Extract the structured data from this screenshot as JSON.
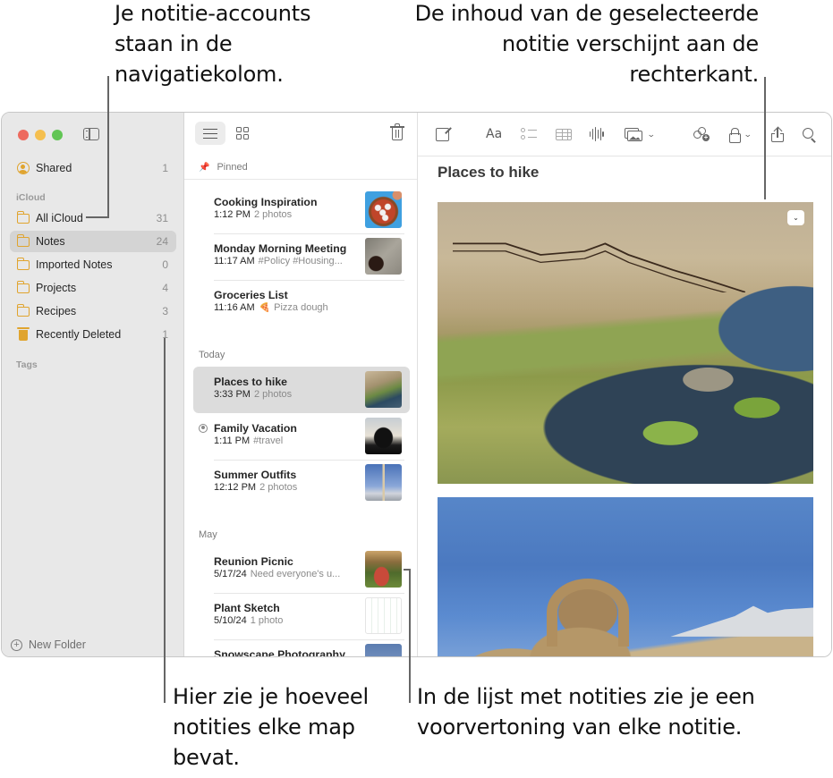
{
  "callouts": {
    "top_left": [
      "Je notitie-accounts",
      "staan in de",
      "navigatiekolom."
    ],
    "top_right": [
      "De inhoud van de geselecteerde",
      "notitie verschijnt aan de",
      "rechterkant."
    ],
    "bottom_left": [
      "Hier zie je hoeveel",
      "notities elke map",
      "bevat."
    ],
    "bottom_right": [
      "In de lijst met notities zie je een",
      "voorvertoning van elke notitie."
    ]
  },
  "sidebar": {
    "shared": {
      "label": "Shared",
      "count": "1",
      "icon": "shared-person-icon"
    },
    "section_icloud": "iCloud",
    "folders": [
      {
        "label": "All iCloud",
        "count": "31",
        "icon": "folder-icon"
      },
      {
        "label": "Notes",
        "count": "24",
        "icon": "folder-icon",
        "selected": true
      },
      {
        "label": "Imported Notes",
        "count": "0",
        "icon": "folder-icon"
      },
      {
        "label": "Projects",
        "count": "4",
        "icon": "folder-icon"
      },
      {
        "label": "Recipes",
        "count": "3",
        "icon": "folder-icon"
      },
      {
        "label": "Recently Deleted",
        "count": "1",
        "icon": "trash-icon"
      }
    ],
    "section_tags": "Tags",
    "new_folder": "New Folder",
    "accent_color": "#e0a42e"
  },
  "notelist": {
    "pinned_header": "Pinned",
    "sections": {
      "today": "Today",
      "may": "May"
    },
    "notes": [
      {
        "title": "Cooking Inspiration",
        "time": "1:12 PM",
        "preview": "2 photos",
        "thumb": "pizza"
      },
      {
        "title": "Monday Morning Meeting",
        "time": "11:17 AM",
        "preview": "#Policy #Housing...",
        "thumb": "meeting"
      },
      {
        "title": "Groceries List",
        "time": "11:16 AM",
        "preview": "Pizza dough",
        "emoji": "🍕"
      },
      {
        "title": "Places to hike",
        "time": "3:33 PM",
        "preview": "2 photos",
        "thumb": "hike",
        "selected": true
      },
      {
        "title": "Family Vacation",
        "time": "1:11 PM",
        "preview": "#travel",
        "thumb": "family",
        "shared": true
      },
      {
        "title": "Summer Outfits",
        "time": "12:12 PM",
        "preview": "2 photos",
        "thumb": "summer"
      },
      {
        "title": "Reunion Picnic",
        "time": "5/17/24",
        "preview": "Need everyone's u...",
        "thumb": "reunion"
      },
      {
        "title": "Plant Sketch",
        "time": "5/10/24",
        "preview": "1 photo",
        "thumb": "plant"
      },
      {
        "title": "Snowscape Photography",
        "time": "",
        "preview": "",
        "thumb": "snow"
      }
    ]
  },
  "editor": {
    "note_title": "Places to hike",
    "toolbar": {
      "format_label": "Aa"
    }
  }
}
